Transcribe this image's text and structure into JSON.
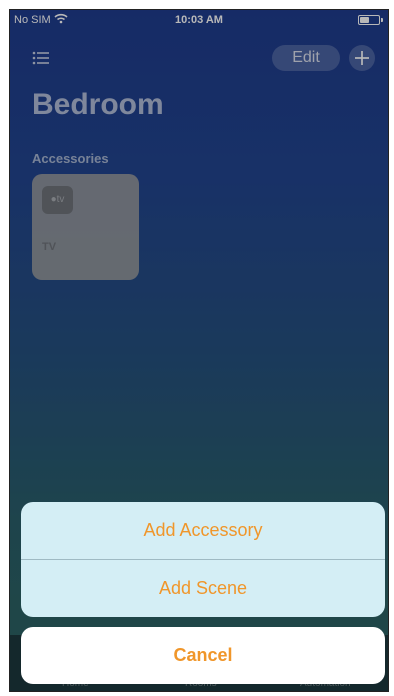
{
  "status_bar": {
    "carrier": "No SIM",
    "time": "10:03 AM"
  },
  "nav": {
    "edit_label": "Edit"
  },
  "page": {
    "title": "Bedroom",
    "section": "Accessories"
  },
  "accessory": {
    "icon_text": "●tv",
    "label": "TV"
  },
  "tabs": [
    "Home",
    "Rooms",
    "Automation"
  ],
  "action_sheet": {
    "add_accessory": "Add Accessory",
    "add_scene": "Add Scene",
    "cancel": "Cancel"
  },
  "colors": {
    "accent": "#f0962a",
    "sheet_bg": "#d4eef5"
  }
}
